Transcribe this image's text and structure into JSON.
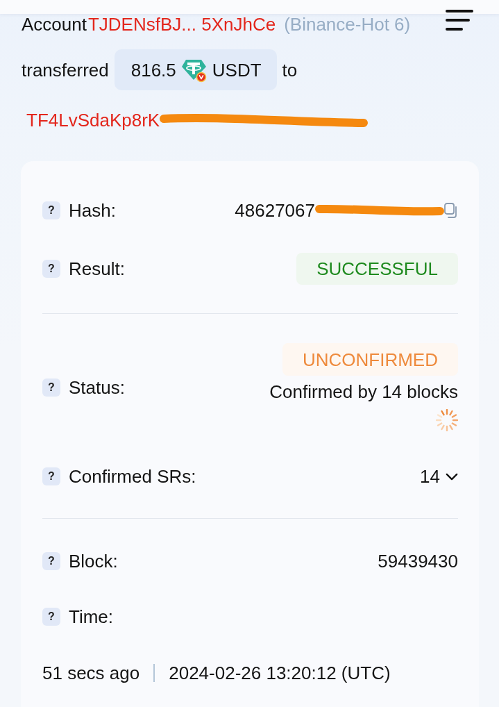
{
  "summary": {
    "account_label": "Account",
    "account": "TJDENsfBJ... 5XnJhCe",
    "account_tag": "(Binance-Hot 6)",
    "transferred_label": "transferred",
    "amount": "816.5",
    "token": "USDT",
    "to_label": "to",
    "recipient": {
      "text": "TF4LvSdaKp8rK",
      "redacted": true
    }
  },
  "details": {
    "sections": [
      {
        "rows": [
          {
            "kind": "hash",
            "hint": "?",
            "label": "Hash:",
            "value": "48627067",
            "redacted": true
          },
          {
            "kind": "badge",
            "hint": "?",
            "label": "Result:",
            "badge": "SUCCESSFUL",
            "color": "#1e8a1e"
          }
        ]
      },
      {
        "rows": [
          {
            "kind": "status",
            "hint": "?",
            "label": "Status:",
            "badge": "UNCONFIRMED",
            "color": "#ee8a3c",
            "note": "Confirmed by 14 blocks",
            "loading": true
          },
          {
            "kind": "dropdown",
            "hint": "?",
            "label": "Confirmed SRs:",
            "value": "14",
            "expanded": false
          }
        ]
      },
      {
        "rows": [
          {
            "kind": "text",
            "hint": "?",
            "label": "Block:",
            "value": "59439430"
          },
          {
            "kind": "time",
            "hint": "?",
            "label": "Time:",
            "ago": "51 secs ago",
            "timestamp": "2024-02-26 13:20:12 (UTC)"
          }
        ]
      }
    ]
  }
}
